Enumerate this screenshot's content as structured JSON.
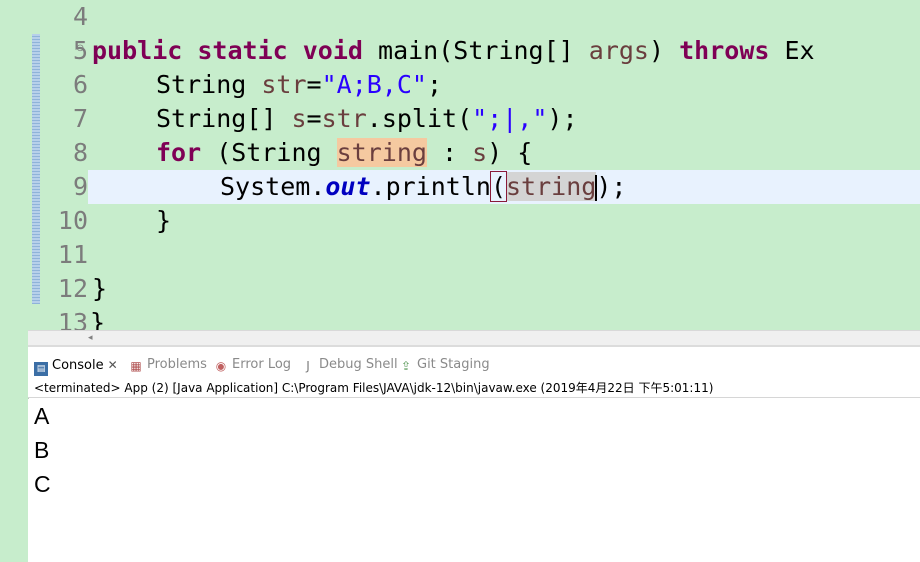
{
  "editor": {
    "line_numbers": [
      "4",
      "5",
      "6",
      "7",
      "8",
      "9",
      "10",
      "11",
      "12",
      "13"
    ],
    "folded_line_marker": "⊖",
    "code": {
      "l5": {
        "kw1": "public",
        "kw2": "static",
        "kw3": "void",
        "name": "main(String[]",
        "param": "args",
        "rest": ")",
        "kw4": "throws",
        "tail": "Ex"
      },
      "l6": {
        "type": "String",
        "var": "str",
        "eq": "=",
        "lit": "\"A;B,C\"",
        "end": ";"
      },
      "l7": {
        "type": "String[]",
        "var": "s",
        "mid": "=",
        "obj": "str",
        "call": ".split(",
        "lit": "\";|,\"",
        "end": ");"
      },
      "l8": {
        "kw": "for",
        "open": " (String ",
        "var": "string",
        "mid": " : ",
        "var2": "s",
        "end": ") {"
      },
      "l9": {
        "obj": "System.",
        "fld": "out",
        "call": ".println",
        "open": "(",
        "var": "string",
        "close": ");"
      },
      "l10": "}",
      "l12": "}",
      "l13": "}"
    }
  },
  "tabs": {
    "console": "Console",
    "problems": "Problems",
    "error_log": "Error Log",
    "debug_shell": "Debug Shell",
    "git_staging": "Git Staging",
    "close_glyph": "✕"
  },
  "console": {
    "header": "<terminated> App (2) [Java Application] C:\\Program Files\\JAVA\\jdk-12\\bin\\javaw.exe (2019年4月22日 下午5:01:11)",
    "output": [
      "A",
      "B",
      "C"
    ]
  },
  "colors": {
    "editor_bg": "#c7edcc",
    "keyword": "#7f0055",
    "string_literal": "#2a00ff",
    "current_line": "#e8f2fe"
  }
}
